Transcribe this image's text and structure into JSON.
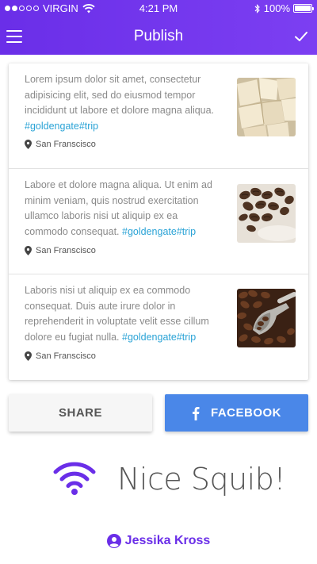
{
  "status_bar": {
    "carrier": "VIRGIN",
    "time": "4:21 PM",
    "battery": "100%",
    "battery_level": 1.0,
    "signal_bars_filled": 2,
    "signal_bars_total": 5
  },
  "navbar": {
    "title": "Publish",
    "menu_icon": "hamburger-menu-icon",
    "confirm_icon": "checkmark-icon"
  },
  "posts": [
    {
      "text": "Lorem ipsum dolor sit amet, consectetur adipisicing elit, sed do eiusmod tempor incididunt ut labore et dolore magna aliqua.",
      "hashtag": "#goldengate#trip",
      "location": "San Franscisco",
      "image": "white-chocolate-pieces"
    },
    {
      "text": "Labore et dolore magna aliqua. Ut enim ad minim veniam, quis nostrud exercitation ullamco laboris nisi ut aliquip ex ea commodo consequat.",
      "hashtag": "#goldengate#trip",
      "location": "San Franscisco",
      "image": "coffee-beans-cup"
    },
    {
      "text": "Laboris nisi ut aliquip ex ea commodo consequat. Duis aute irure dolor in reprehenderit in voluptate velit esse cillum dolore eu fugiat nulla.",
      "hashtag": "#goldengate#trip",
      "location": "San Franscisco",
      "image": "coffee-beans-scoop"
    }
  ],
  "actions": {
    "share_label": "SHARE",
    "facebook_label": "FACEBOOK"
  },
  "footer": {
    "message": "Nice Squib!",
    "user_name": "Jessika Kross"
  },
  "colors": {
    "brand": "#6a2ee8",
    "facebook": "#4a87e8",
    "hashtag": "#2aa3d6"
  }
}
